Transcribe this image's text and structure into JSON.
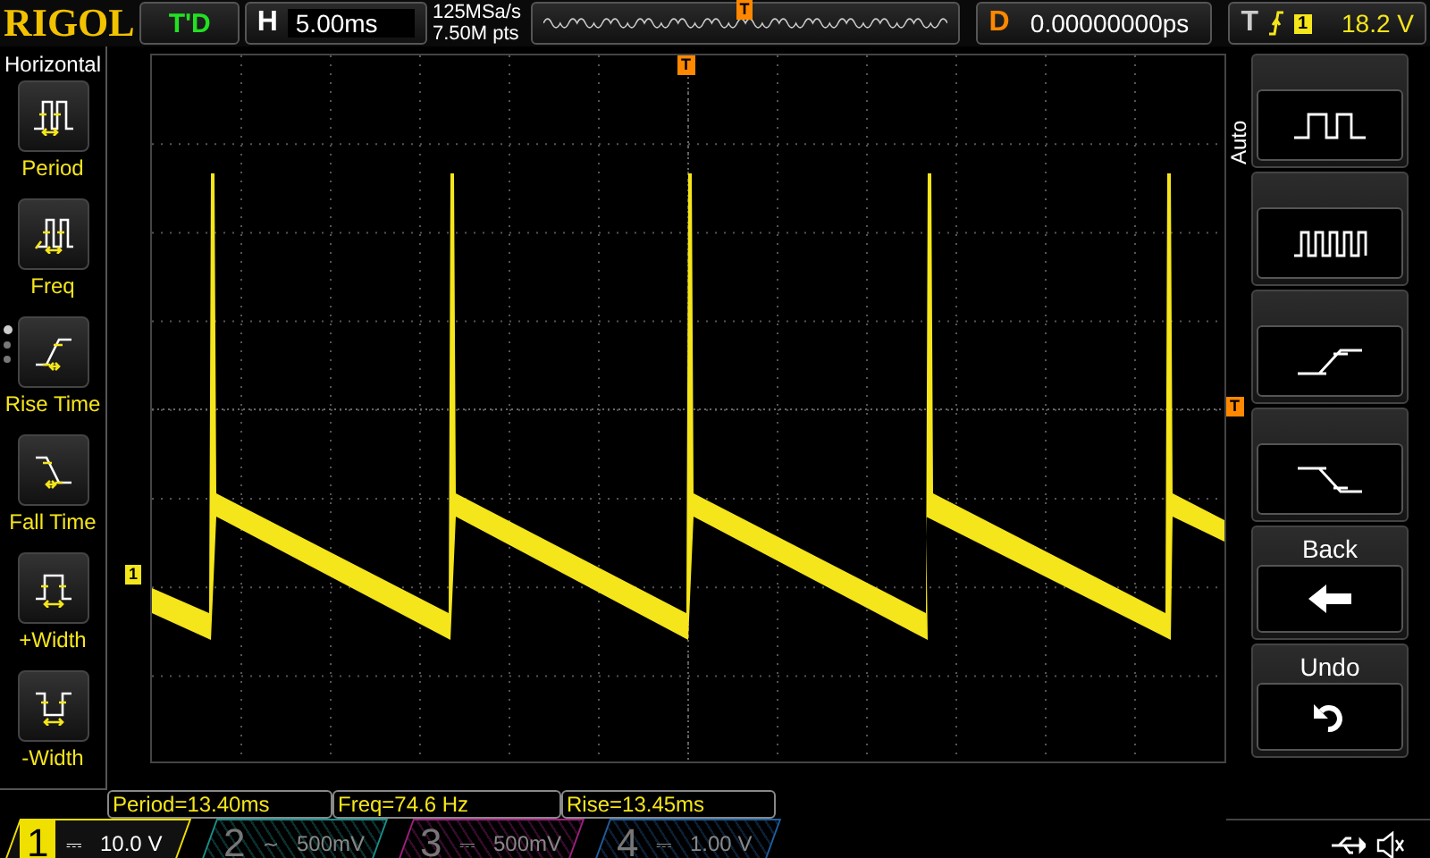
{
  "header": {
    "logo": "RIGOL",
    "run_status": "T'D",
    "timebase": {
      "label": "H",
      "value": "5.00ms"
    },
    "sample_rate": "125MSa/s",
    "memory_depth": "7.50M pts",
    "delay": {
      "label": "D",
      "value": "0.00000000ps"
    },
    "trigger": {
      "label": "T",
      "source": "1",
      "level": "18.2 V"
    }
  },
  "left_menu": {
    "title": "Horizontal",
    "pages": [
      {
        "selected": true
      },
      {
        "selected": false
      },
      {
        "selected": false
      }
    ],
    "items": [
      {
        "kind": "period",
        "label": "Period"
      },
      {
        "kind": "freq",
        "label": "Freq"
      },
      {
        "kind": "rise",
        "label": "Rise Time"
      },
      {
        "kind": "fall",
        "label": "Fall Time"
      },
      {
        "kind": "pwidth",
        "label": "+Width"
      },
      {
        "kind": "nwidth",
        "label": "-Width"
      }
    ]
  },
  "markers": {
    "overview_trigger": "T",
    "trigger_position": "T",
    "trigger_level": "T",
    "channel": "1"
  },
  "right_menu": {
    "mode": "Auto",
    "buttons": [
      {
        "kind": "single"
      },
      {
        "kind": "train"
      },
      {
        "kind": "rise"
      },
      {
        "kind": "fall"
      },
      {
        "kind": "back",
        "label": "Back"
      },
      {
        "kind": "undo",
        "label": "Undo"
      }
    ]
  },
  "measurements": [
    "Period=13.40ms",
    "Freq=74.6 Hz",
    "Rise=13.45ms"
  ],
  "channels": [
    {
      "number": "1",
      "coupling": "⎓",
      "scale": "10.0 V",
      "on": true,
      "color": "#f0e000"
    },
    {
      "number": "2",
      "coupling": "~",
      "scale": "500mV",
      "on": false,
      "color": "#1a8f8a"
    },
    {
      "number": "3",
      "coupling": "⎓",
      "scale": "500mV",
      "on": false,
      "color": "#a0207f"
    },
    {
      "number": "4",
      "coupling": "⎓",
      "scale": "1.00 V",
      "on": false,
      "color": "#1f5f9f"
    }
  ]
}
